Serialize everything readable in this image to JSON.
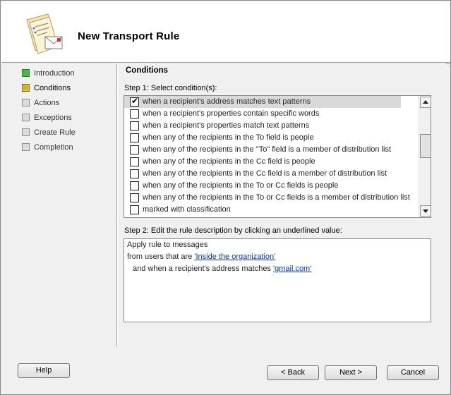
{
  "window": {
    "title": "New Transport Rule"
  },
  "nav": {
    "items": [
      {
        "label": "Introduction",
        "state": "complete"
      },
      {
        "label": "Conditions",
        "state": "current"
      },
      {
        "label": "Actions",
        "state": "pending"
      },
      {
        "label": "Exceptions",
        "state": "pending"
      },
      {
        "label": "Create Rule",
        "state": "pending"
      },
      {
        "label": "Completion",
        "state": "pending"
      }
    ]
  },
  "main": {
    "section_title": "Conditions",
    "step1_label": "Step 1: Select condition(s):",
    "conditions": [
      {
        "label": "when a recipient's address matches text patterns",
        "checked": true,
        "selected": true
      },
      {
        "label": "when a recipient's properties contain specific words",
        "checked": false
      },
      {
        "label": "when a recipient's properties match text patterns",
        "checked": false
      },
      {
        "label": "when any of the recipients in the To field is people",
        "checked": false
      },
      {
        "label": "when any of the recipients in the \"To\" field is a member of distribution list",
        "checked": false
      },
      {
        "label": "when any of the recipients in the Cc field is people",
        "checked": false
      },
      {
        "label": "when any of the recipients in the Cc field is a member of distribution list",
        "checked": false
      },
      {
        "label": "when any of the recipients in the To or Cc fields is people",
        "checked": false
      },
      {
        "label": "when any of the recipients in the To or Cc fields is a member of distribution list",
        "checked": false
      },
      {
        "label": "marked with classification",
        "checked": false
      }
    ],
    "step2_label": "Step 2: Edit the rule description by clicking an underlined value:",
    "description": {
      "line1": "Apply rule to messages",
      "line2_prefix": "from users that are ",
      "line2_link": "'Inside the organization'",
      "line3_prefix": "and when a recipient's address matches ",
      "line3_link": "'gmail.com'"
    }
  },
  "footer": {
    "help_label": "Help",
    "back_label": "< Back",
    "next_label": "Next >",
    "cancel_label": "Cancel"
  },
  "colors": {
    "link": "#0033cc",
    "selection": "#d9d9d9",
    "nav_complete": "#48b848",
    "nav_current": "#d0b020"
  }
}
